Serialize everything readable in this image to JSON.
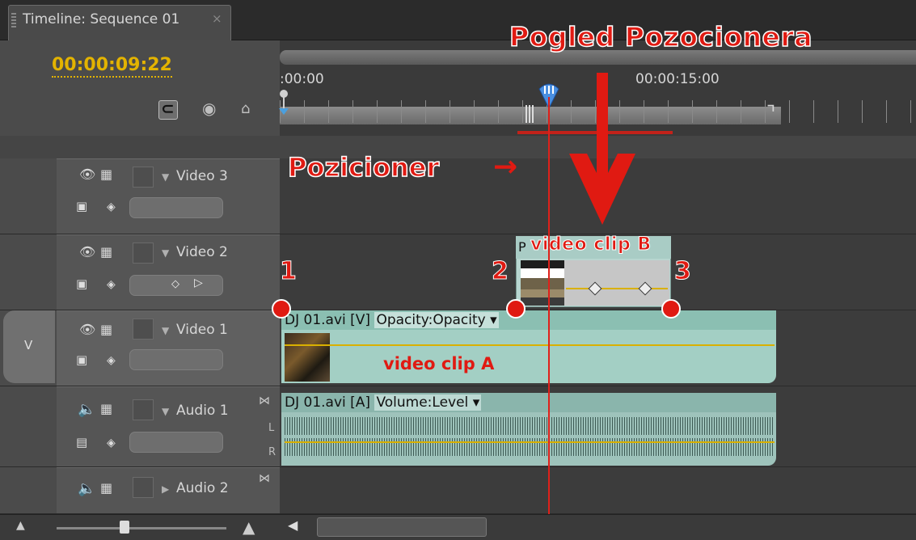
{
  "panel": {
    "tab_title": "Timeline: Sequence 01",
    "tab_close": "×",
    "timecode": "00:00:09:22"
  },
  "ruler": {
    "start_label": ":00:00",
    "mark_label": "00:00:15:00"
  },
  "annotations": {
    "view_title": "Pogled Pozocionera",
    "playhead_label": "Pozicioner",
    "playhead_arrow": "→",
    "point_1": "1",
    "point_2": "2",
    "point_3": "3",
    "clip_a_label": "video clip A",
    "clip_b_label": "video clip B",
    "accent_color": "#e01a12"
  },
  "tracks": [
    {
      "name": "Video 3",
      "kind": "video"
    },
    {
      "name": "Video 2",
      "kind": "video"
    },
    {
      "name": "Video 1",
      "kind": "video",
      "target": "V"
    },
    {
      "name": "Audio 1",
      "kind": "audio"
    },
    {
      "name": "Audio 2",
      "kind": "audio"
    }
  ],
  "clips": {
    "video1": {
      "name": "DJ 01.avi [V]",
      "effect": "Opacity:Opacity",
      "dropdown": "▾"
    },
    "video2": {
      "prefix": "P"
    },
    "audio1": {
      "name": "DJ 01.avi [A]",
      "effect": "Volume:Level",
      "dropdown": "▾",
      "ch_l": "L",
      "ch_r": "R"
    }
  },
  "icons": {
    "eye": "eye-icon",
    "film": "filmstrip-icon",
    "speaker": "speaker-icon",
    "snap": "snap-icon",
    "marker": "marker-icon",
    "home": "home-icon"
  },
  "zoom_level": 0.4
}
